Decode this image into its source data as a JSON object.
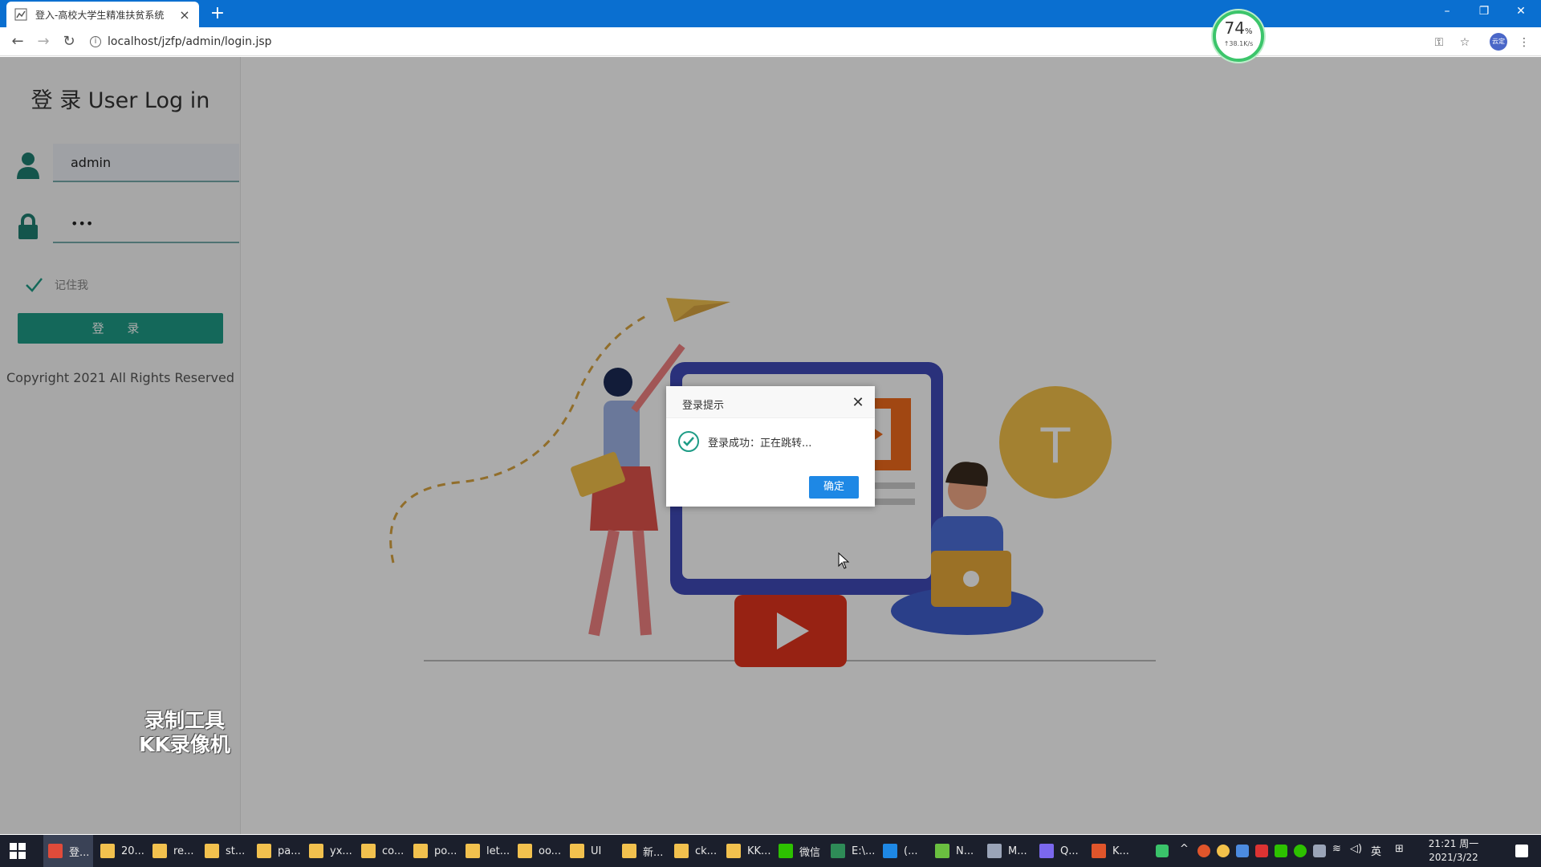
{
  "browser": {
    "tab_title": "登入-高校大学生精准扶贫系统",
    "new_tab": "+",
    "url": "localhost/jzfp/admin/login.jsp",
    "profile_label": "云定",
    "minimize": "–",
    "restore": "❐",
    "close": "✕"
  },
  "speed_meter": {
    "percent": "74",
    "percent_sign": "%",
    "rate": "↑38.1K/s"
  },
  "login": {
    "title": "登 录 User Log in",
    "username": "admin",
    "password_mask": "•••",
    "remember_label": "记住我",
    "button_label": "登 录",
    "copyright": "Copyright 2021 All Rights Reserved"
  },
  "dialog": {
    "title": "登录提示",
    "message": "登录成功：正在跳转...",
    "confirm_label": "确定",
    "close_glyph": "✕"
  },
  "watermark": {
    "line1": "录制工具",
    "line2": "KK录像机"
  },
  "taskbar": {
    "items": [
      {
        "label": "登...",
        "color": "#e04b3a"
      },
      {
        "label": "20...",
        "color": "#f2c14e"
      },
      {
        "label": "re...",
        "color": "#f2c14e"
      },
      {
        "label": "st...",
        "color": "#f2c14e"
      },
      {
        "label": "pa...",
        "color": "#f2c14e"
      },
      {
        "label": "yx...",
        "color": "#f2c14e"
      },
      {
        "label": "co...",
        "color": "#f2c14e"
      },
      {
        "label": "po...",
        "color": "#f2c14e"
      },
      {
        "label": "let...",
        "color": "#f2c14e"
      },
      {
        "label": "oo...",
        "color": "#f2c14e"
      },
      {
        "label": "UI",
        "color": "#f2c14e"
      },
      {
        "label": "新...",
        "color": "#f2c14e"
      },
      {
        "label": "ck...",
        "color": "#f2c14e"
      },
      {
        "label": "KK...",
        "color": "#f2c14e"
      },
      {
        "label": "微信",
        "color": "#2dc100"
      },
      {
        "label": "E:\\...",
        "color": "#2e8b57"
      },
      {
        "label": "(...",
        "color": "#1e88e5"
      },
      {
        "label": "N...",
        "color": "#6abf40"
      },
      {
        "label": "M...",
        "color": "#9aa4b8"
      },
      {
        "label": "Q...",
        "color": "#7b68ee"
      },
      {
        "label": "K...",
        "color": "#e0552b"
      }
    ],
    "ime": "英",
    "time": "21:21 周一",
    "date": "2021/3/22"
  },
  "colors": {
    "accent": "#1e9c86",
    "dialog_button": "#1e88e5",
    "browser_bar": "#0a6fd0"
  }
}
